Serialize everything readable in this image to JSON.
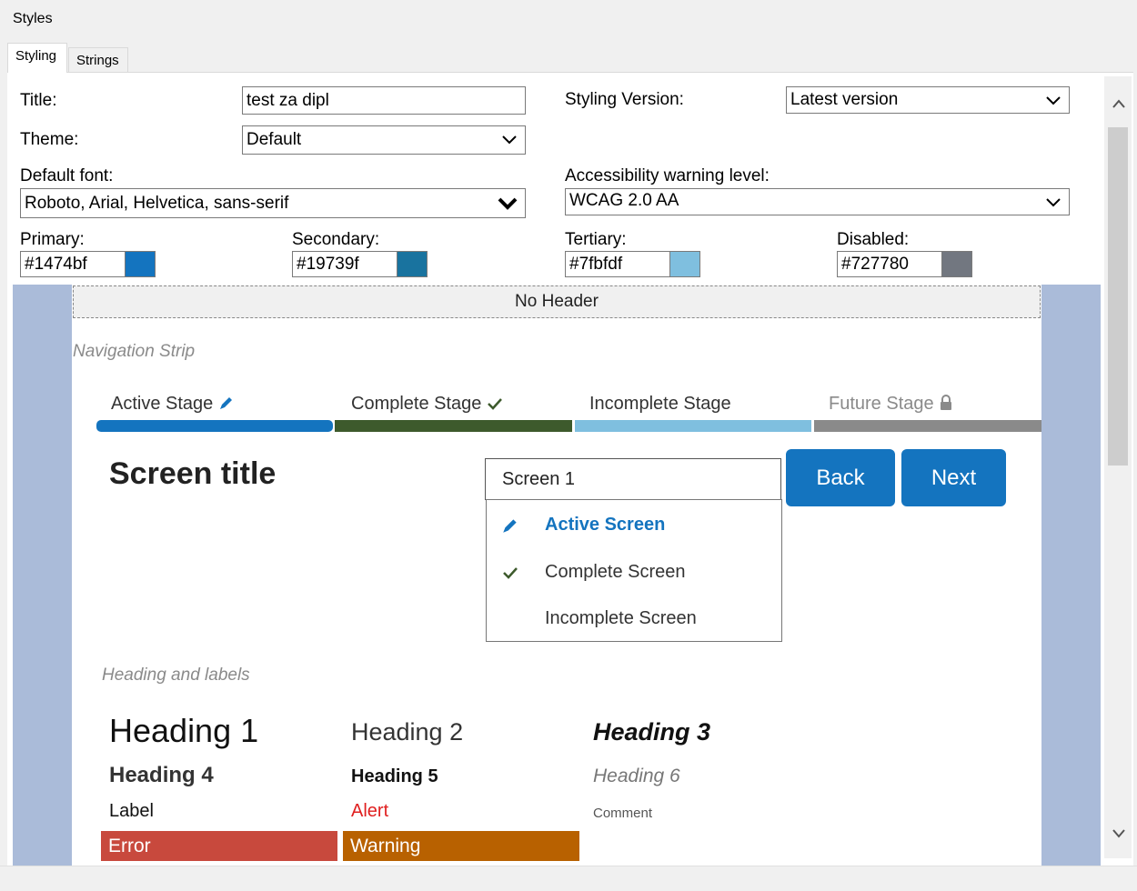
{
  "window": {
    "title": "Styles"
  },
  "tabs": [
    {
      "label": "Styling",
      "active": true
    },
    {
      "label": "Strings",
      "active": false
    }
  ],
  "form": {
    "title_label": "Title:",
    "title_value": "test za dipl",
    "styling_version_label": "Styling Version:",
    "styling_version_value": "Latest version",
    "theme_label": "Theme:",
    "theme_value": "Default",
    "default_font_label": "Default font:",
    "default_font_value": "Roboto, Arial, Helvetica, sans-serif",
    "accessibility_label": "Accessibility warning level:",
    "accessibility_value": "WCAG 2.0 AA"
  },
  "colors": [
    {
      "label": "Primary:",
      "value": "#1474bf",
      "swatch": "#1474bf"
    },
    {
      "label": "Secondary:",
      "value": "#19739f",
      "swatch": "#19739f"
    },
    {
      "label": "Tertiary:",
      "value": "#7fbfdf",
      "swatch": "#7fbfdf"
    },
    {
      "label": "Disabled:",
      "value": "#727780",
      "swatch": "#727780"
    }
  ],
  "preview": {
    "header_text": "No Header",
    "nav_strip_label": "Navigation Strip",
    "stages": [
      {
        "label": "Active Stage",
        "icon": "pencil-icon",
        "bar_color": "#1474bf",
        "text_color": "#333333"
      },
      {
        "label": "Complete Stage",
        "icon": "check-icon",
        "bar_color": "#3d5a2c",
        "text_color": "#333333"
      },
      {
        "label": "Incomplete Stage",
        "icon": "",
        "bar_color": "#7fbfdf",
        "text_color": "#333333"
      },
      {
        "label": "Future Stage",
        "icon": "lock-icon",
        "bar_color": "#8a8a8a",
        "text_color": "#8a8a8a"
      }
    ],
    "screen_title": "Screen title",
    "screen_select_value": "Screen 1",
    "back_label": "Back",
    "next_label": "Next",
    "screen_menu": [
      {
        "label": "Active Screen",
        "icon": "pencil-icon",
        "active": true
      },
      {
        "label": "Complete Screen",
        "icon": "check-icon",
        "active": false
      },
      {
        "label": "Incomplete Screen",
        "icon": "",
        "active": false
      }
    ],
    "heading_section_label": "Heading and labels",
    "headings": {
      "h1": "Heading 1",
      "h2": "Heading 2",
      "h3": "Heading 3",
      "h4": "Heading 4",
      "h5": "Heading 5",
      "h6": "Heading 6",
      "label": "Label",
      "alert": "Alert",
      "comment": "Comment",
      "error": "Error",
      "warning": "Warning"
    },
    "accent": {
      "primary": "#1474bf",
      "error_bg": "#c8493d",
      "warning_bg": "#b86100",
      "alert_text": "#e02020",
      "lane_bg": "#aabbd9"
    }
  }
}
